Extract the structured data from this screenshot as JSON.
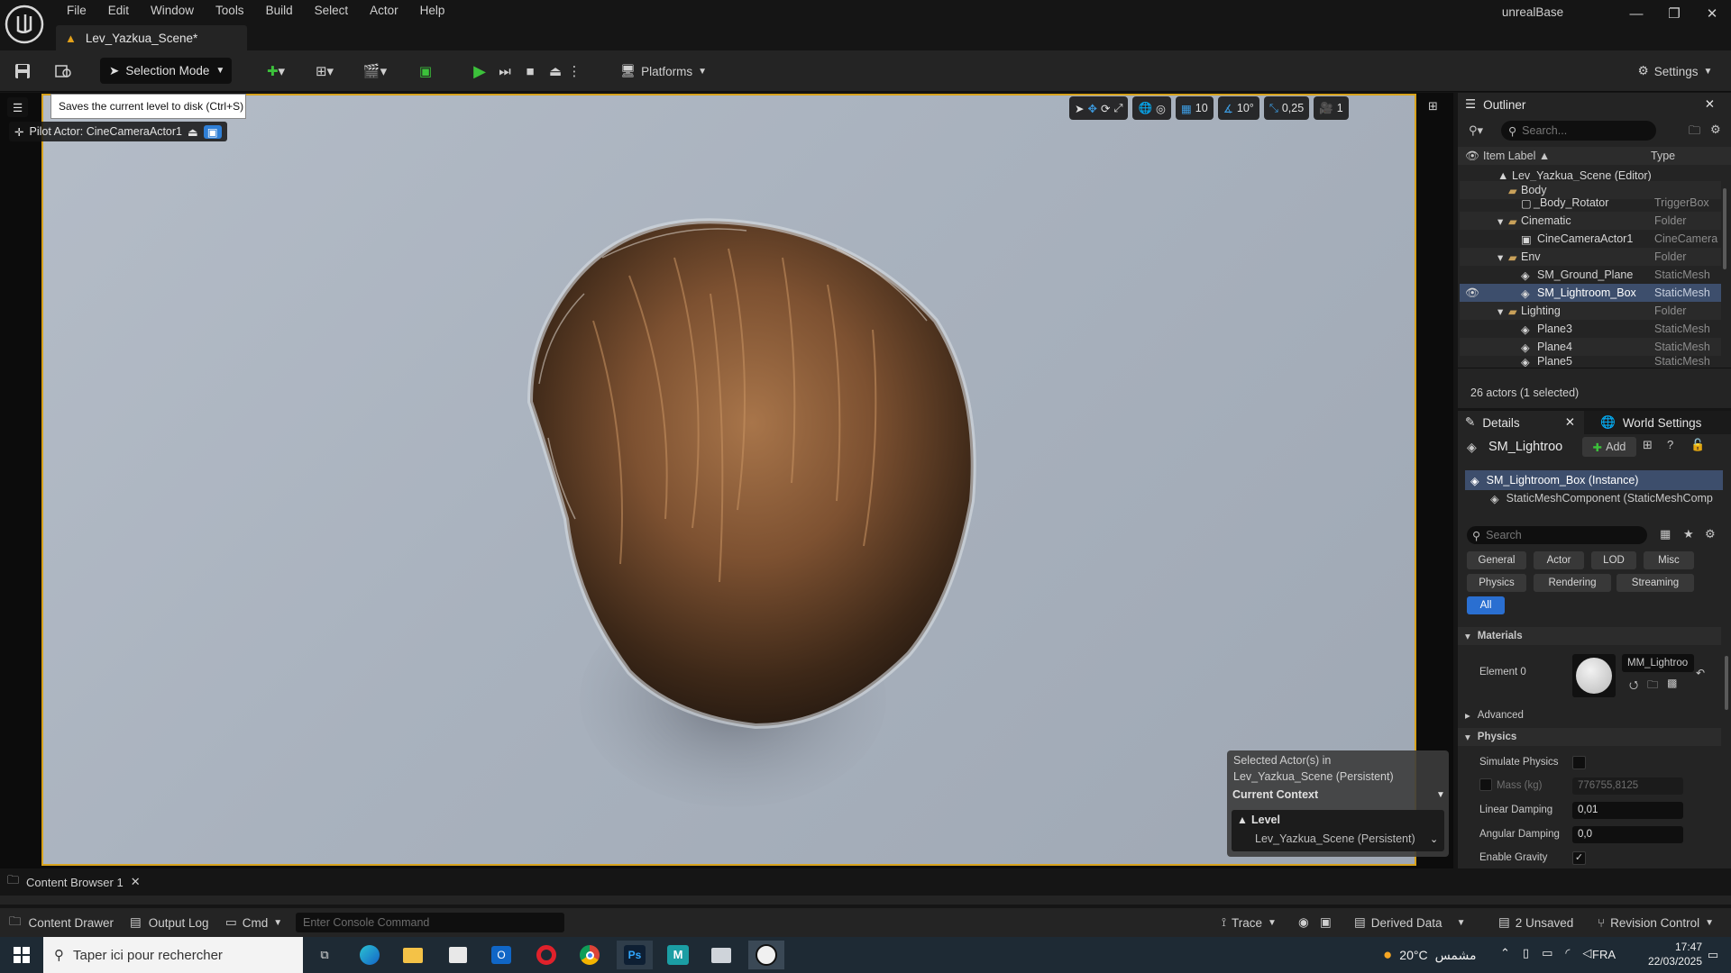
{
  "app": {
    "title": "unrealBase",
    "doc_tab": "Lev_Yazkua_Scene*"
  },
  "menu": [
    "File",
    "Edit",
    "Window",
    "Tools",
    "Build",
    "Select",
    "Actor",
    "Help"
  ],
  "toolbar": {
    "selection_mode": "Selection Mode",
    "platforms": "Platforms",
    "settings": "Settings"
  },
  "tooltip": "Saves the current level to disk (Ctrl+S)",
  "viewport": {
    "pilot_label": "Pilot Actor: CineCameraActor1",
    "grid_value": "10",
    "rotation_snap": "10°",
    "scale_snap": "0,25",
    "camera_speed": "1"
  },
  "context": {
    "selected_line1": "Selected Actor(s) in",
    "selected_line2": "Lev_Yazkua_Scene (Persistent)",
    "current_context": "Current Context",
    "level_label": "Level",
    "level_value": "Lev_Yazkua_Scene (Persistent)"
  },
  "outliner": {
    "title": "Outliner",
    "search_placeholder": "Search...",
    "col_label": "Item Label ▲",
    "col_type": "Type",
    "rows": [
      {
        "label": "Lev_Yazkua_Scene (Editor)",
        "type": ""
      },
      {
        "label": "Body",
        "type": ""
      },
      {
        "label": "_Body_Rotator",
        "type": "TriggerBox"
      },
      {
        "label": "Cinematic",
        "type": "Folder"
      },
      {
        "label": "CineCameraActor1",
        "type": "CineCamera"
      },
      {
        "label": "Env",
        "type": "Folder"
      },
      {
        "label": "SM_Ground_Plane",
        "type": "StaticMesh"
      },
      {
        "label": "SM_Lightroom_Box",
        "type": "StaticMesh"
      },
      {
        "label": "Lighting",
        "type": "Folder"
      },
      {
        "label": "Plane3",
        "type": "StaticMesh"
      },
      {
        "label": "Plane4",
        "type": "StaticMesh"
      },
      {
        "label": "Plane5",
        "type": "StaticMesh"
      }
    ],
    "footer": "26 actors (1 selected)"
  },
  "details": {
    "tab_details": "Details",
    "tab_world": "World Settings",
    "actor_name": "SM_Lightroo",
    "add_label": "Add",
    "instance_label": "SM_Lightroom_Box (Instance)",
    "component_label": "StaticMeshComponent (StaticMeshComp",
    "search_placeholder": "Search",
    "filters_row1": [
      "General",
      "Actor",
      "LOD",
      "Misc"
    ],
    "filters_row2": [
      "Physics",
      "Rendering",
      "Streaming"
    ],
    "filter_all": "All",
    "materials_header": "Materials",
    "element0": "Element 0",
    "material_name": "MM_Lightroo",
    "advanced": "Advanced",
    "physics_header": "Physics",
    "simulate_physics": "Simulate Physics",
    "mass_label": "Mass (kg)",
    "mass_value": "776755,8125",
    "linear_damping_label": "Linear Damping",
    "linear_damping": "0,01",
    "angular_damping_label": "Angular Damping",
    "angular_damping": "0,0",
    "enable_gravity": "Enable Gravity"
  },
  "bottom": {
    "content_browser_tab": "Content Browser 1",
    "content_drawer": "Content Drawer",
    "output_log": "Output Log",
    "cmd": "Cmd",
    "console_placeholder": "Enter Console Command",
    "trace": "Trace",
    "derived_data": "Derived Data",
    "unsaved": "2 Unsaved",
    "revision_control": "Revision Control"
  },
  "taskbar": {
    "search_placeholder": "Taper ici pour rechercher",
    "weather": "20°C",
    "weather_text": "مشمس",
    "lang": "FRA",
    "time": "17:47",
    "date": "22/03/2025"
  },
  "colors": {
    "accent_orange": "#d7a21c",
    "selection_blue": "#3d4e6c",
    "play_green": "#3cc13b"
  }
}
